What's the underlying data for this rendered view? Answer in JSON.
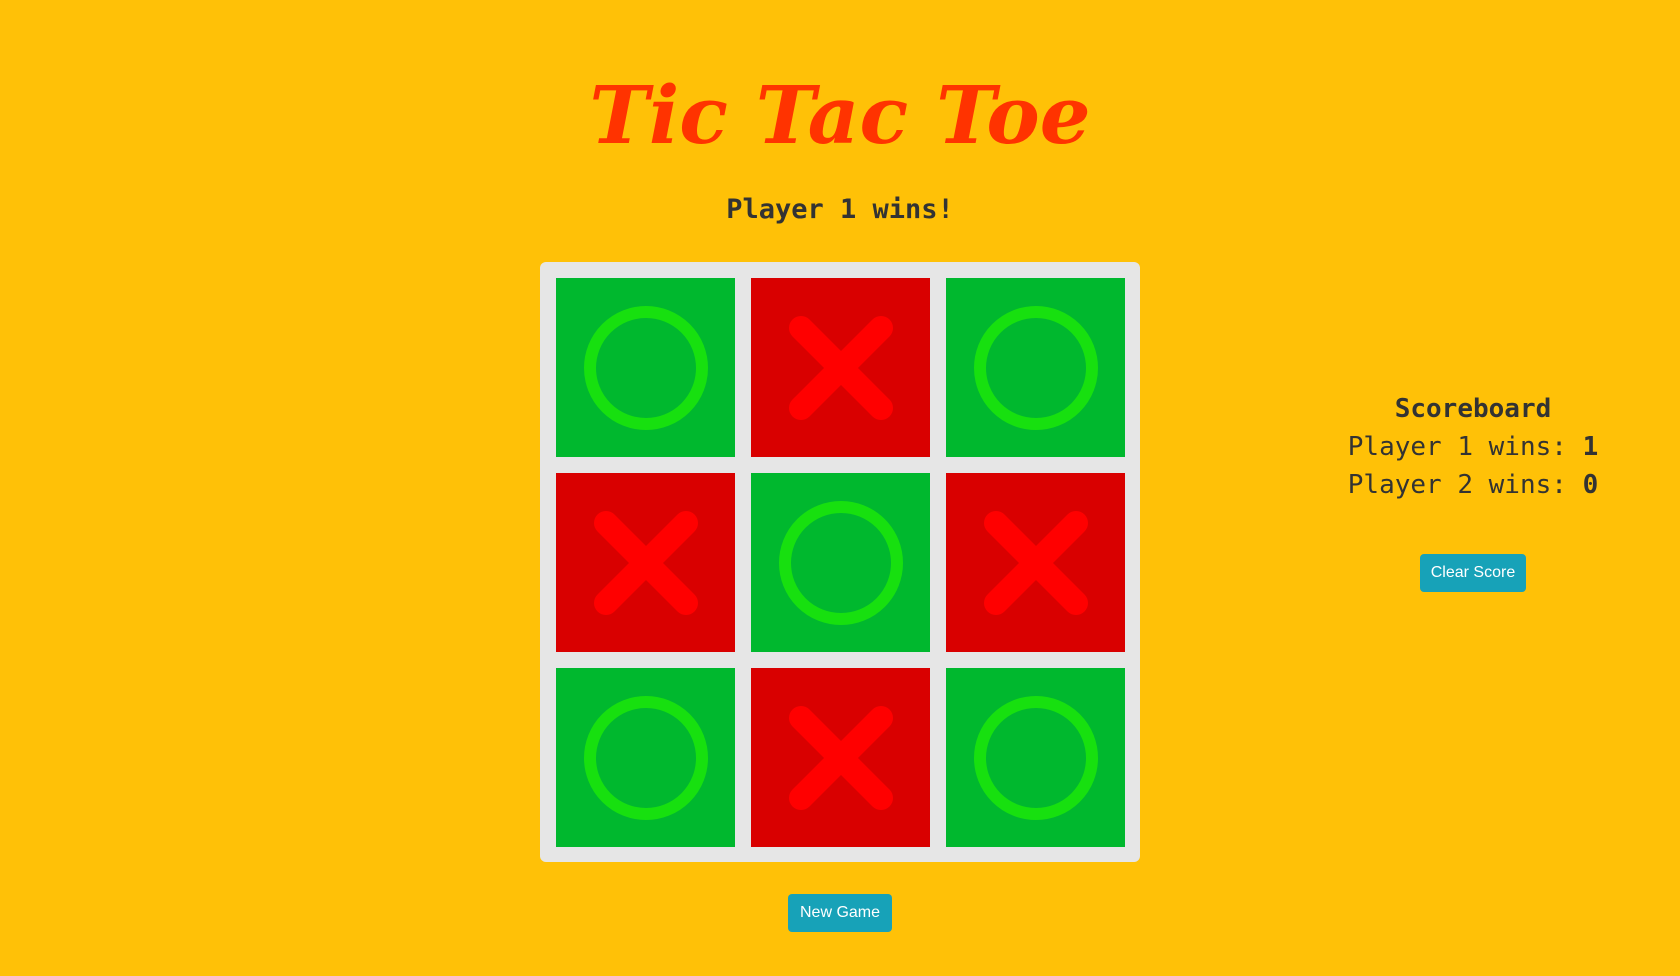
{
  "title": "Tic Tac Toe",
  "status": "Player 1 wins!",
  "colors": {
    "background": "#ffc107",
    "title": "#ff3300",
    "board_frame": "#e6e6e6",
    "o_cell": "#00b82e",
    "o_mark": "#17e00f",
    "x_cell": "#d90000",
    "x_mark": "#ff0000",
    "button": "#17a2b8"
  },
  "board": {
    "cells": [
      "O",
      "X",
      "O",
      "X",
      "O",
      "X",
      "O",
      "X",
      "O"
    ]
  },
  "buttons": {
    "new_game": "New Game",
    "clear_score": "Clear Score"
  },
  "scoreboard": {
    "title": "Scoreboard",
    "player1_label": "Player 1 wins: ",
    "player1_value": "1",
    "player2_label": "Player 2 wins: ",
    "player2_value": "0"
  }
}
